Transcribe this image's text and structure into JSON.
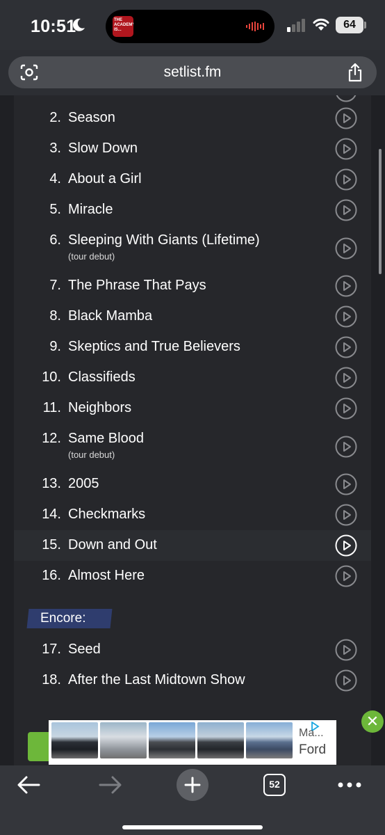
{
  "status": {
    "time": "10:51",
    "battery": "64",
    "now_playing_art_text": "THE ACADEMY IS..."
  },
  "browser": {
    "url": "setlist.fm",
    "tab_count": "52"
  },
  "setlist": {
    "songs": [
      {
        "num": "2.",
        "title": "Season",
        "note": ""
      },
      {
        "num": "3.",
        "title": "Slow Down",
        "note": ""
      },
      {
        "num": "4.",
        "title": "About a Girl",
        "note": ""
      },
      {
        "num": "5.",
        "title": "Miracle",
        "note": ""
      },
      {
        "num": "6.",
        "title": "Sleeping With Giants (Lifetime)",
        "note": "(tour debut)"
      },
      {
        "num": "7.",
        "title": "The Phrase That Pays",
        "note": ""
      },
      {
        "num": "8.",
        "title": "Black Mamba",
        "note": ""
      },
      {
        "num": "9.",
        "title": "Skeptics and True Believers",
        "note": ""
      },
      {
        "num": "10.",
        "title": "Classifieds",
        "note": ""
      },
      {
        "num": "11.",
        "title": "Neighbors",
        "note": ""
      },
      {
        "num": "12.",
        "title": "Same Blood",
        "note": "(tour debut)"
      },
      {
        "num": "13.",
        "title": "2005",
        "note": ""
      },
      {
        "num": "14.",
        "title": "Checkmarks",
        "note": ""
      },
      {
        "num": "15.",
        "title": "Down and Out",
        "note": ""
      },
      {
        "num": "16.",
        "title": "Almost Here",
        "note": ""
      }
    ],
    "encore_label": "Encore:",
    "encore_songs": [
      {
        "num": "17.",
        "title": "Seed",
        "note": ""
      },
      {
        "num": "18.",
        "title": "After the Last Midtown Show",
        "note": ""
      }
    ]
  },
  "ad": {
    "text_line1": "Ma...",
    "text_line2": "Ford"
  },
  "colors": {
    "page_bg": "#26272b",
    "encore_highlight": "#2f3d6e",
    "ad_accent": "#6db73a"
  }
}
